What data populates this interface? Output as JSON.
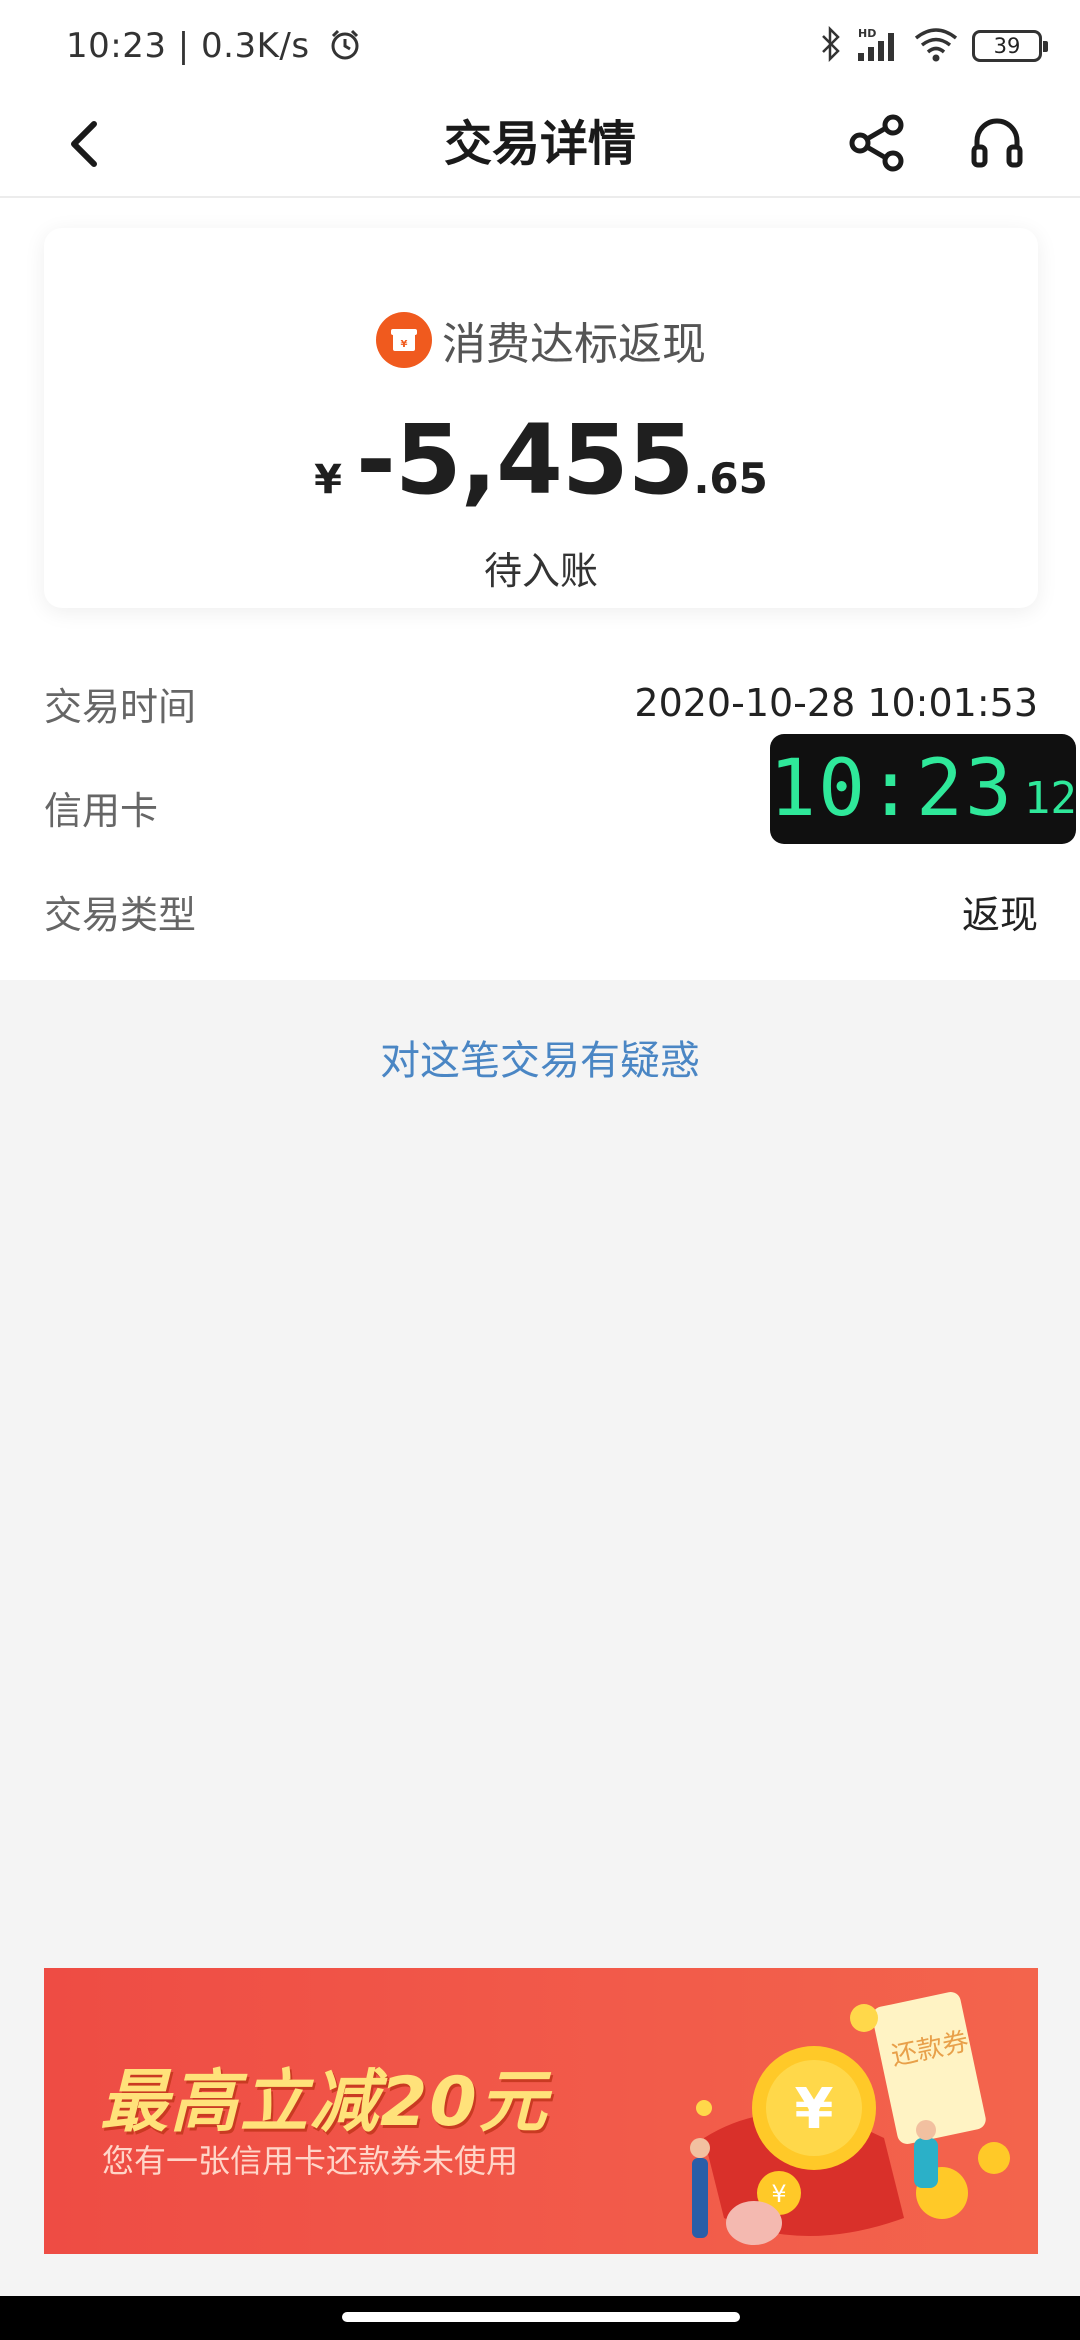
{
  "status_bar": {
    "time_speed": "10:23 | 0.3K/s",
    "battery": "39",
    "network_label": "HD"
  },
  "header": {
    "title": "交易详情"
  },
  "summary": {
    "category": "消费达标返现",
    "currency": "¥",
    "amount_main": "-5,455",
    "amount_decimal": ".65",
    "status": "待入账"
  },
  "details": [
    {
      "label": "交易时间",
      "value": "2020-10-28 10:01:53"
    },
    {
      "label": "信用卡",
      "value": ""
    },
    {
      "label": "交易类型",
      "value": "返现"
    }
  ],
  "clock_overlay": {
    "time": "10:23",
    "seconds": "12"
  },
  "dispute_link": "对这笔交易有疑惑",
  "promo": {
    "title": "最高立减20元",
    "subtitle": "您有一张信用卡还款券未使用",
    "coupon_text": "还款券"
  },
  "colors": {
    "accent_orange": "#f05a1e",
    "link_blue": "#4a86c4",
    "clock_green": "#2fe89a",
    "banner_red": "#ee4c44"
  }
}
